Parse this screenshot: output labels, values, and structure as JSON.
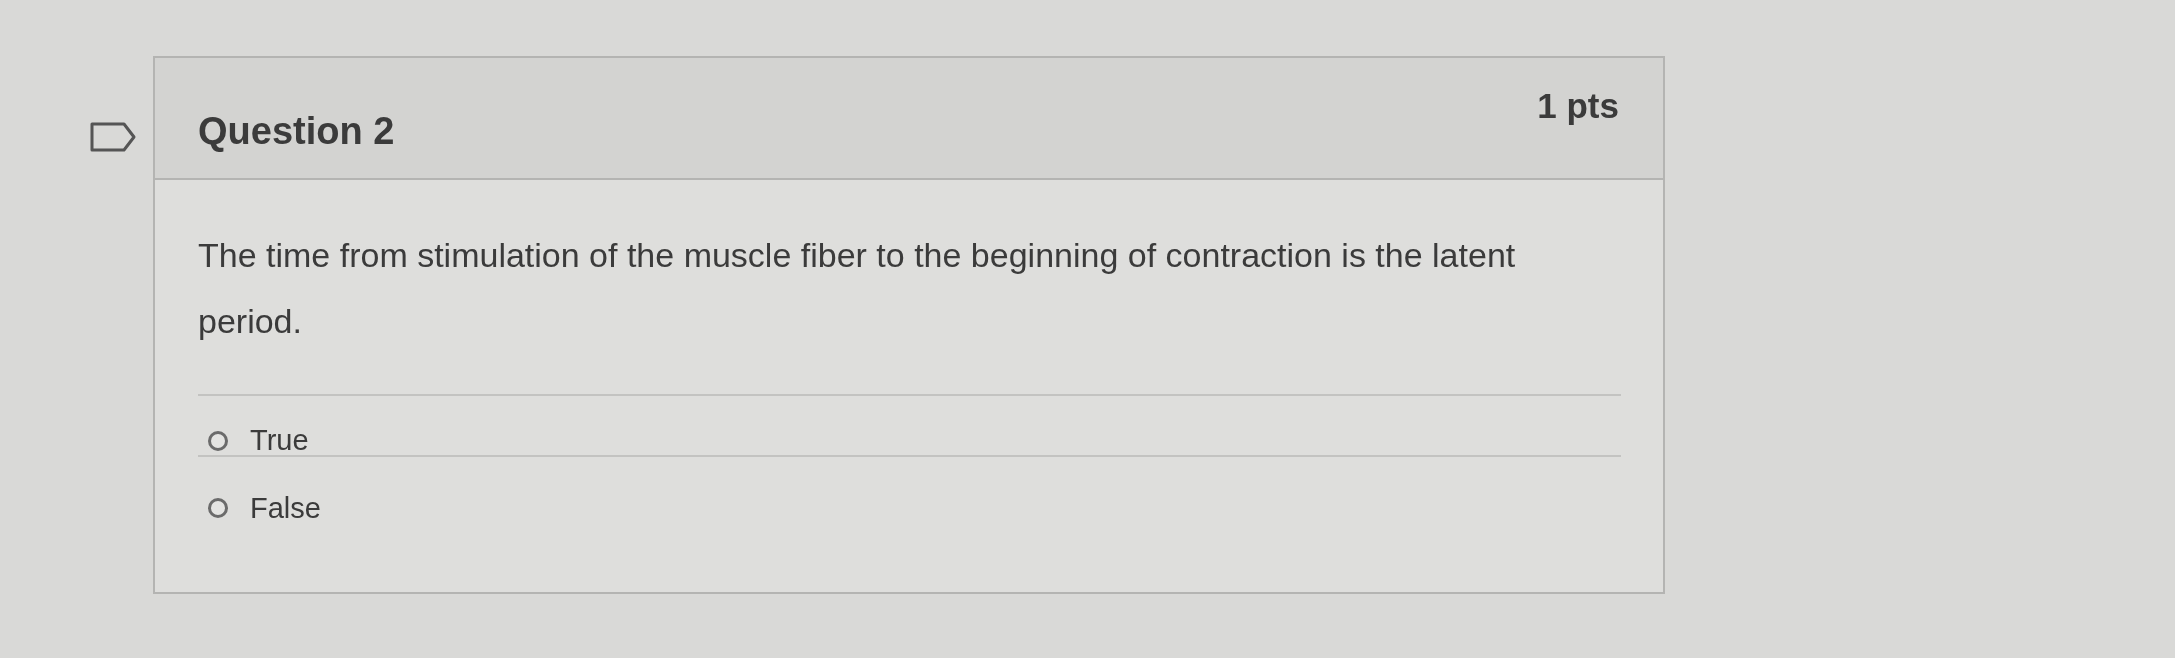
{
  "question": {
    "flagged": false,
    "title": "Question 2",
    "points": "1 pts",
    "text": "The time from stimulation of the muscle fiber to the beginning of contraction is the latent period.",
    "answers": [
      {
        "label": "True",
        "selected": false
      },
      {
        "label": "False",
        "selected": false
      }
    ]
  }
}
